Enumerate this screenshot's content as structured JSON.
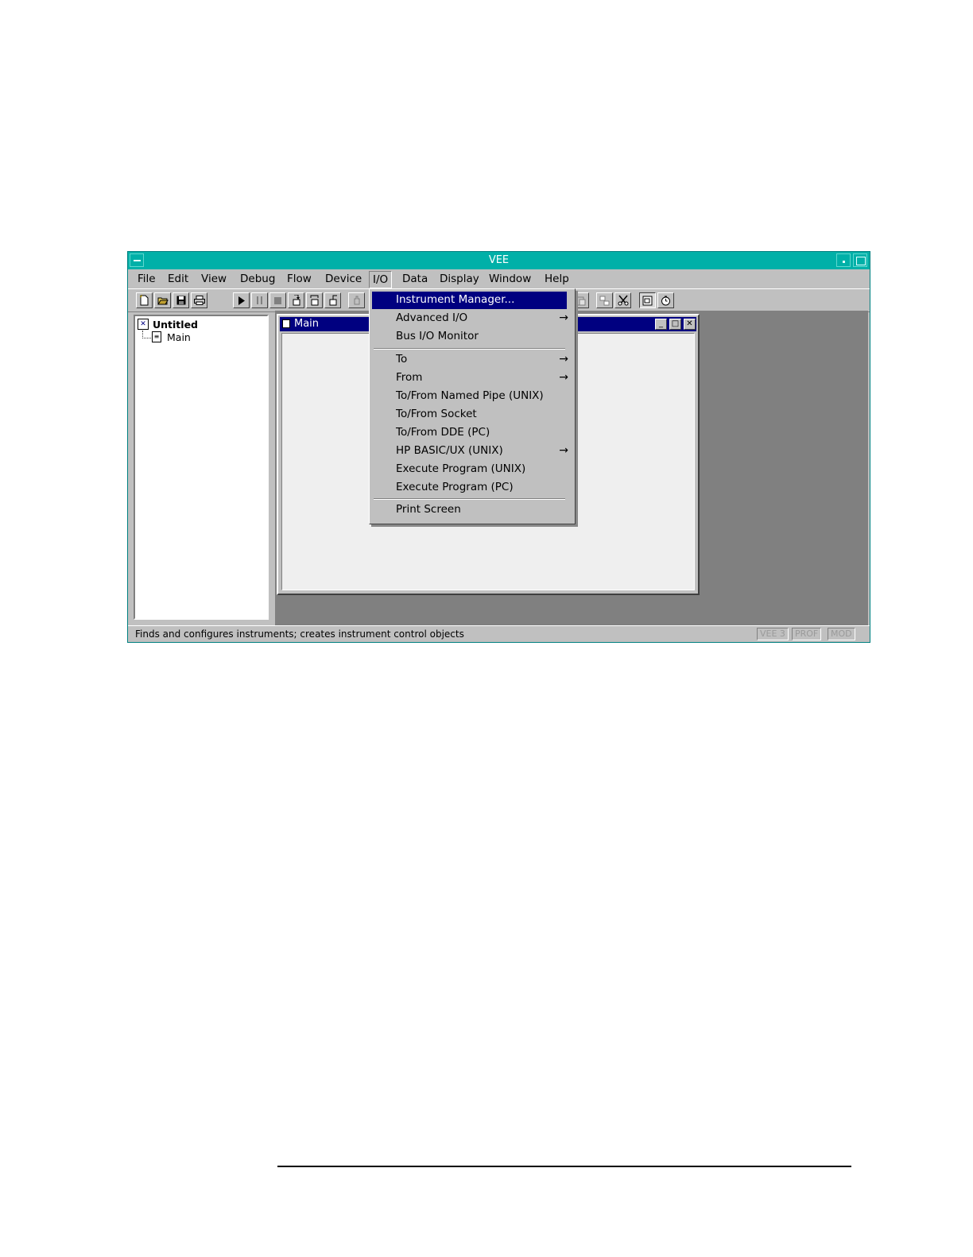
{
  "window": {
    "title": "VEE"
  },
  "menubar": {
    "items": [
      "File",
      "Edit",
      "View",
      "Debug",
      "Flow",
      "Device",
      "I/O",
      "Data",
      "Display",
      "Window",
      "Help"
    ]
  },
  "toolbar": {
    "icons": [
      "new-icon",
      "open-icon",
      "save-icon",
      "print-icon",
      "run-icon",
      "pause-icon",
      "stop-icon",
      "step-into-icon",
      "step-over-icon",
      "step-out-icon",
      "probe-icon",
      "paste-icon",
      "toggle-detail-icon",
      "cut-icon",
      "panel-view-icon",
      "timer-icon"
    ]
  },
  "tree": {
    "root": "Untitled",
    "child": "Main"
  },
  "main_window": {
    "title": "Main"
  },
  "io_menu": {
    "items": [
      {
        "label": "Instrument Manager...",
        "selected": true
      },
      {
        "label": "Advanced I/O",
        "submenu": true
      },
      {
        "label": "Bus I/O Monitor"
      },
      {
        "label": "To",
        "submenu": true
      },
      {
        "label": "From",
        "submenu": true
      },
      {
        "label": "To/From Named Pipe (UNIX)"
      },
      {
        "label": "To/From Socket"
      },
      {
        "label": "To/From DDE (PC)"
      },
      {
        "label": "HP BASIC/UX (UNIX)",
        "submenu": true
      },
      {
        "label": "Execute Program (UNIX)"
      },
      {
        "label": "Execute Program (PC)"
      },
      {
        "label": "Print Screen"
      }
    ],
    "arrow": "→"
  },
  "statusbar": {
    "message": "Finds and configures instruments; creates instrument control objects",
    "indicators": [
      "VEE 3",
      "PROF",
      "MOD"
    ]
  },
  "colors": {
    "titlebar": "#00b0a8",
    "caption": "#000080",
    "workspace": "#808080",
    "menu_bg": "#c0c0c0"
  }
}
